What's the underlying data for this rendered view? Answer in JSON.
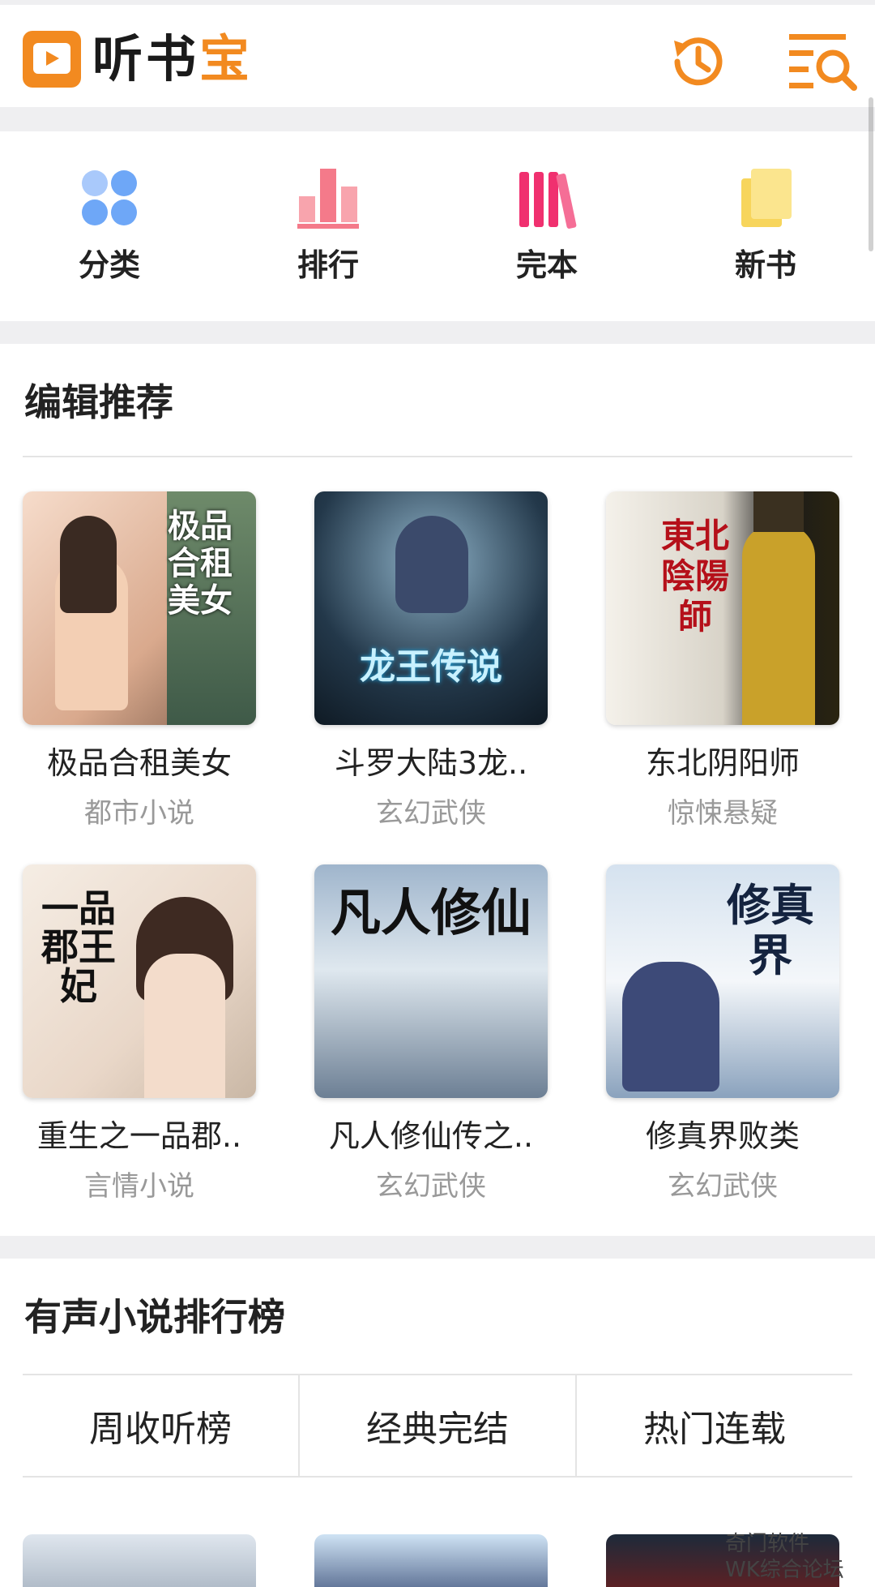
{
  "header": {
    "logo_text_dark": "听书",
    "logo_text_accent": "宝",
    "history_icon": "history-icon",
    "search_menu_icon": "search-list-icon"
  },
  "nav": [
    {
      "label": "分类",
      "icon": "category-icon"
    },
    {
      "label": "排行",
      "icon": "ranking-icon"
    },
    {
      "label": "完本",
      "icon": "complete-books-icon"
    },
    {
      "label": "新书",
      "icon": "new-books-icon"
    }
  ],
  "editor_picks": {
    "title": "编辑推荐",
    "books": [
      {
        "title": "极品合租美女",
        "category": "都市小说",
        "cover_text": "极品合租美女"
      },
      {
        "title": "斗罗大陆3龙..",
        "category": "玄幻武侠",
        "cover_text": "龙王传说"
      },
      {
        "title": "东北阴阳师",
        "category": "惊悚悬疑",
        "cover_text": "東北陰陽師"
      },
      {
        "title": "重生之一品郡..",
        "category": "言情小说",
        "cover_text": "一品郡王妃"
      },
      {
        "title": "凡人修仙传之..",
        "category": "玄幻武侠",
        "cover_text": "凡人修仙"
      },
      {
        "title": "修真界败类",
        "category": "玄幻武侠",
        "cover_text": "修真界"
      }
    ]
  },
  "ranking": {
    "title": "有声小说排行榜",
    "tabs": [
      "周收听榜",
      "经典完结",
      "热门连载"
    ]
  },
  "watermark": {
    "line1": "奇门软件",
    "line2": "WK综合论坛"
  },
  "colors": {
    "accent": "#f28a20",
    "nav_blue": "#6ea7f7",
    "nav_pink": "#f47a8a",
    "nav_magenta": "#f0306f",
    "nav_yellow": "#f7d55c"
  }
}
